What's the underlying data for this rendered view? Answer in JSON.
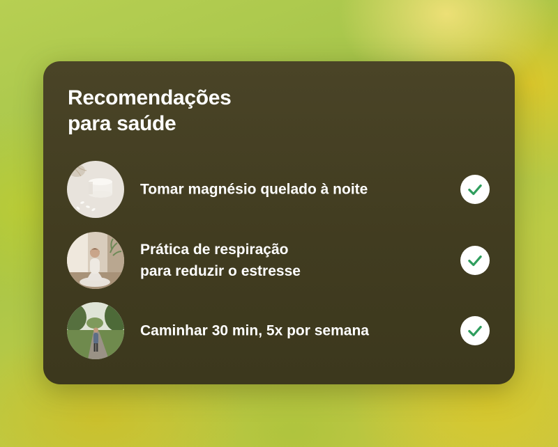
{
  "card": {
    "title_line1": "Recomendações",
    "title_line2": "para saúde"
  },
  "items": [
    {
      "thumbnail": "supplement-jar-photo",
      "label_lines": [
        "Tomar magnésio quelado à noite"
      ],
      "checked": true,
      "check_icon": "check-icon"
    },
    {
      "thumbnail": "meditation-photo",
      "label_lines": [
        "Prática de respiração",
        "para reduzir o estresse"
      ],
      "checked": true,
      "check_icon": "check-icon"
    },
    {
      "thumbnail": "park-walk-photo",
      "label_lines": [
        "Caminhar 30 min, 5x por semana"
      ],
      "checked": true,
      "check_icon": "check-icon"
    }
  ],
  "colors": {
    "card_background": "#433e22",
    "text": "#ffffff",
    "check_circle": "#ffffff",
    "check_mark": "#2f9e5e"
  }
}
